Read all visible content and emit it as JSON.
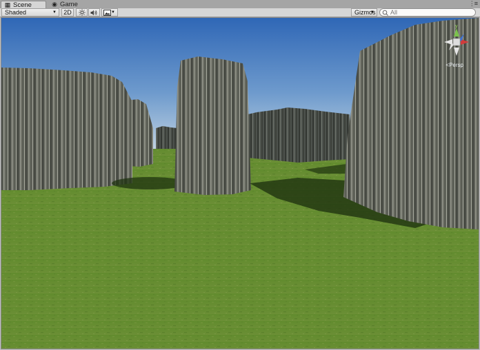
{
  "tabs": [
    {
      "label": "Scene",
      "icon": "scene-icon",
      "active": true
    },
    {
      "label": "Game",
      "icon": "game-controller-icon",
      "active": false
    }
  ],
  "toolbar": {
    "shading_mode": "Shaded",
    "mode_2d_label": "2D",
    "lighting_icon": "sun-icon",
    "audio_icon": "speaker-icon",
    "effects_icon": "image-icon",
    "gizmos_label": "Gizmos",
    "search": {
      "value": "",
      "placeholder": "All"
    }
  },
  "viewport": {
    "projection_label": "Persp",
    "orientation_gizmo": {
      "up_axis": "y"
    },
    "sky_color_top": "#2f67b6",
    "sky_color_horizon": "#c8d7e3",
    "ground_color": "#5e8a2c"
  }
}
